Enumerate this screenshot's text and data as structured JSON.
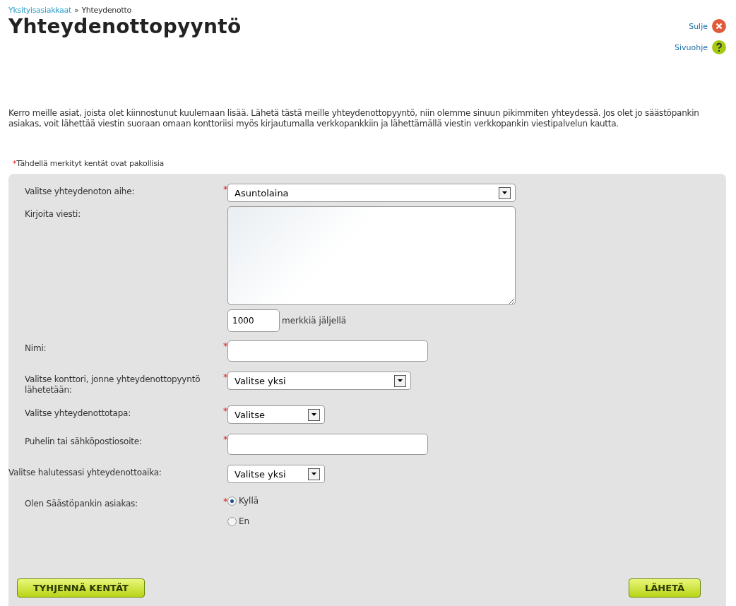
{
  "breadcrumb": {
    "link": "Yksityisasiakkaat",
    "separator": "»",
    "current": "Yhteydenotto"
  },
  "title": "Yhteydenottopyyntö",
  "header_links": [
    {
      "kind": "close",
      "label": "Sulje"
    },
    {
      "kind": "help",
      "label": "Sivuohje"
    }
  ],
  "intro": "Kerro meille asiat, joista olet kiinnostunut kuulemaan lisää. Lähetä tästä meille yhteydenottopyyntö, niin olemme sinuun pikimmiten yhteydessä. Jos olet jo säästöpankin asiakas, voit lähettää viestin suoraan omaan konttoriisi myös kirjautumalla verkkopankkiin ja lähettämällä viestin verkkopankin viestipalvelun kautta.",
  "required_note": {
    "mark": "*",
    "text": "Tähdellä merkityt kentät ovat pakollisia"
  },
  "fields": [
    {
      "kind": "select",
      "label": "Valitse yhteydenoton aihe:",
      "required": true,
      "value": "Asuntolaina"
    },
    {
      "kind": "textarea",
      "label": "Kirjoita viesti:",
      "required": false,
      "counter": "1000",
      "counter_text": "merkkiä jäljellä"
    },
    {
      "kind": "text",
      "label": "Nimi:",
      "required": true
    },
    {
      "kind": "select",
      "label": "Valitse konttori, jonne yhteydenottopyyntö lähetetään:",
      "required": true,
      "value": "Valitse yksi"
    },
    {
      "kind": "select",
      "label": "Valitse yhteydenottotapa:",
      "required": true,
      "value": "Valitse"
    },
    {
      "kind": "text",
      "label": "Puhelin tai sähköpostiosoite:",
      "required": true
    },
    {
      "kind": "select",
      "label": "Valitse halutessasi yhteydenottoaika:",
      "required": false,
      "value": "Valitse yksi"
    },
    {
      "kind": "radio",
      "label": "Olen Säästöpankin asiakas:",
      "required": true,
      "options": [
        {
          "label": "Kyllä",
          "selected": true
        },
        {
          "label": "En",
          "selected": false
        }
      ]
    }
  ],
  "buttons": {
    "clear": "TYHJENNÄ KENTÄT",
    "submit": "LÄHETÄ"
  }
}
